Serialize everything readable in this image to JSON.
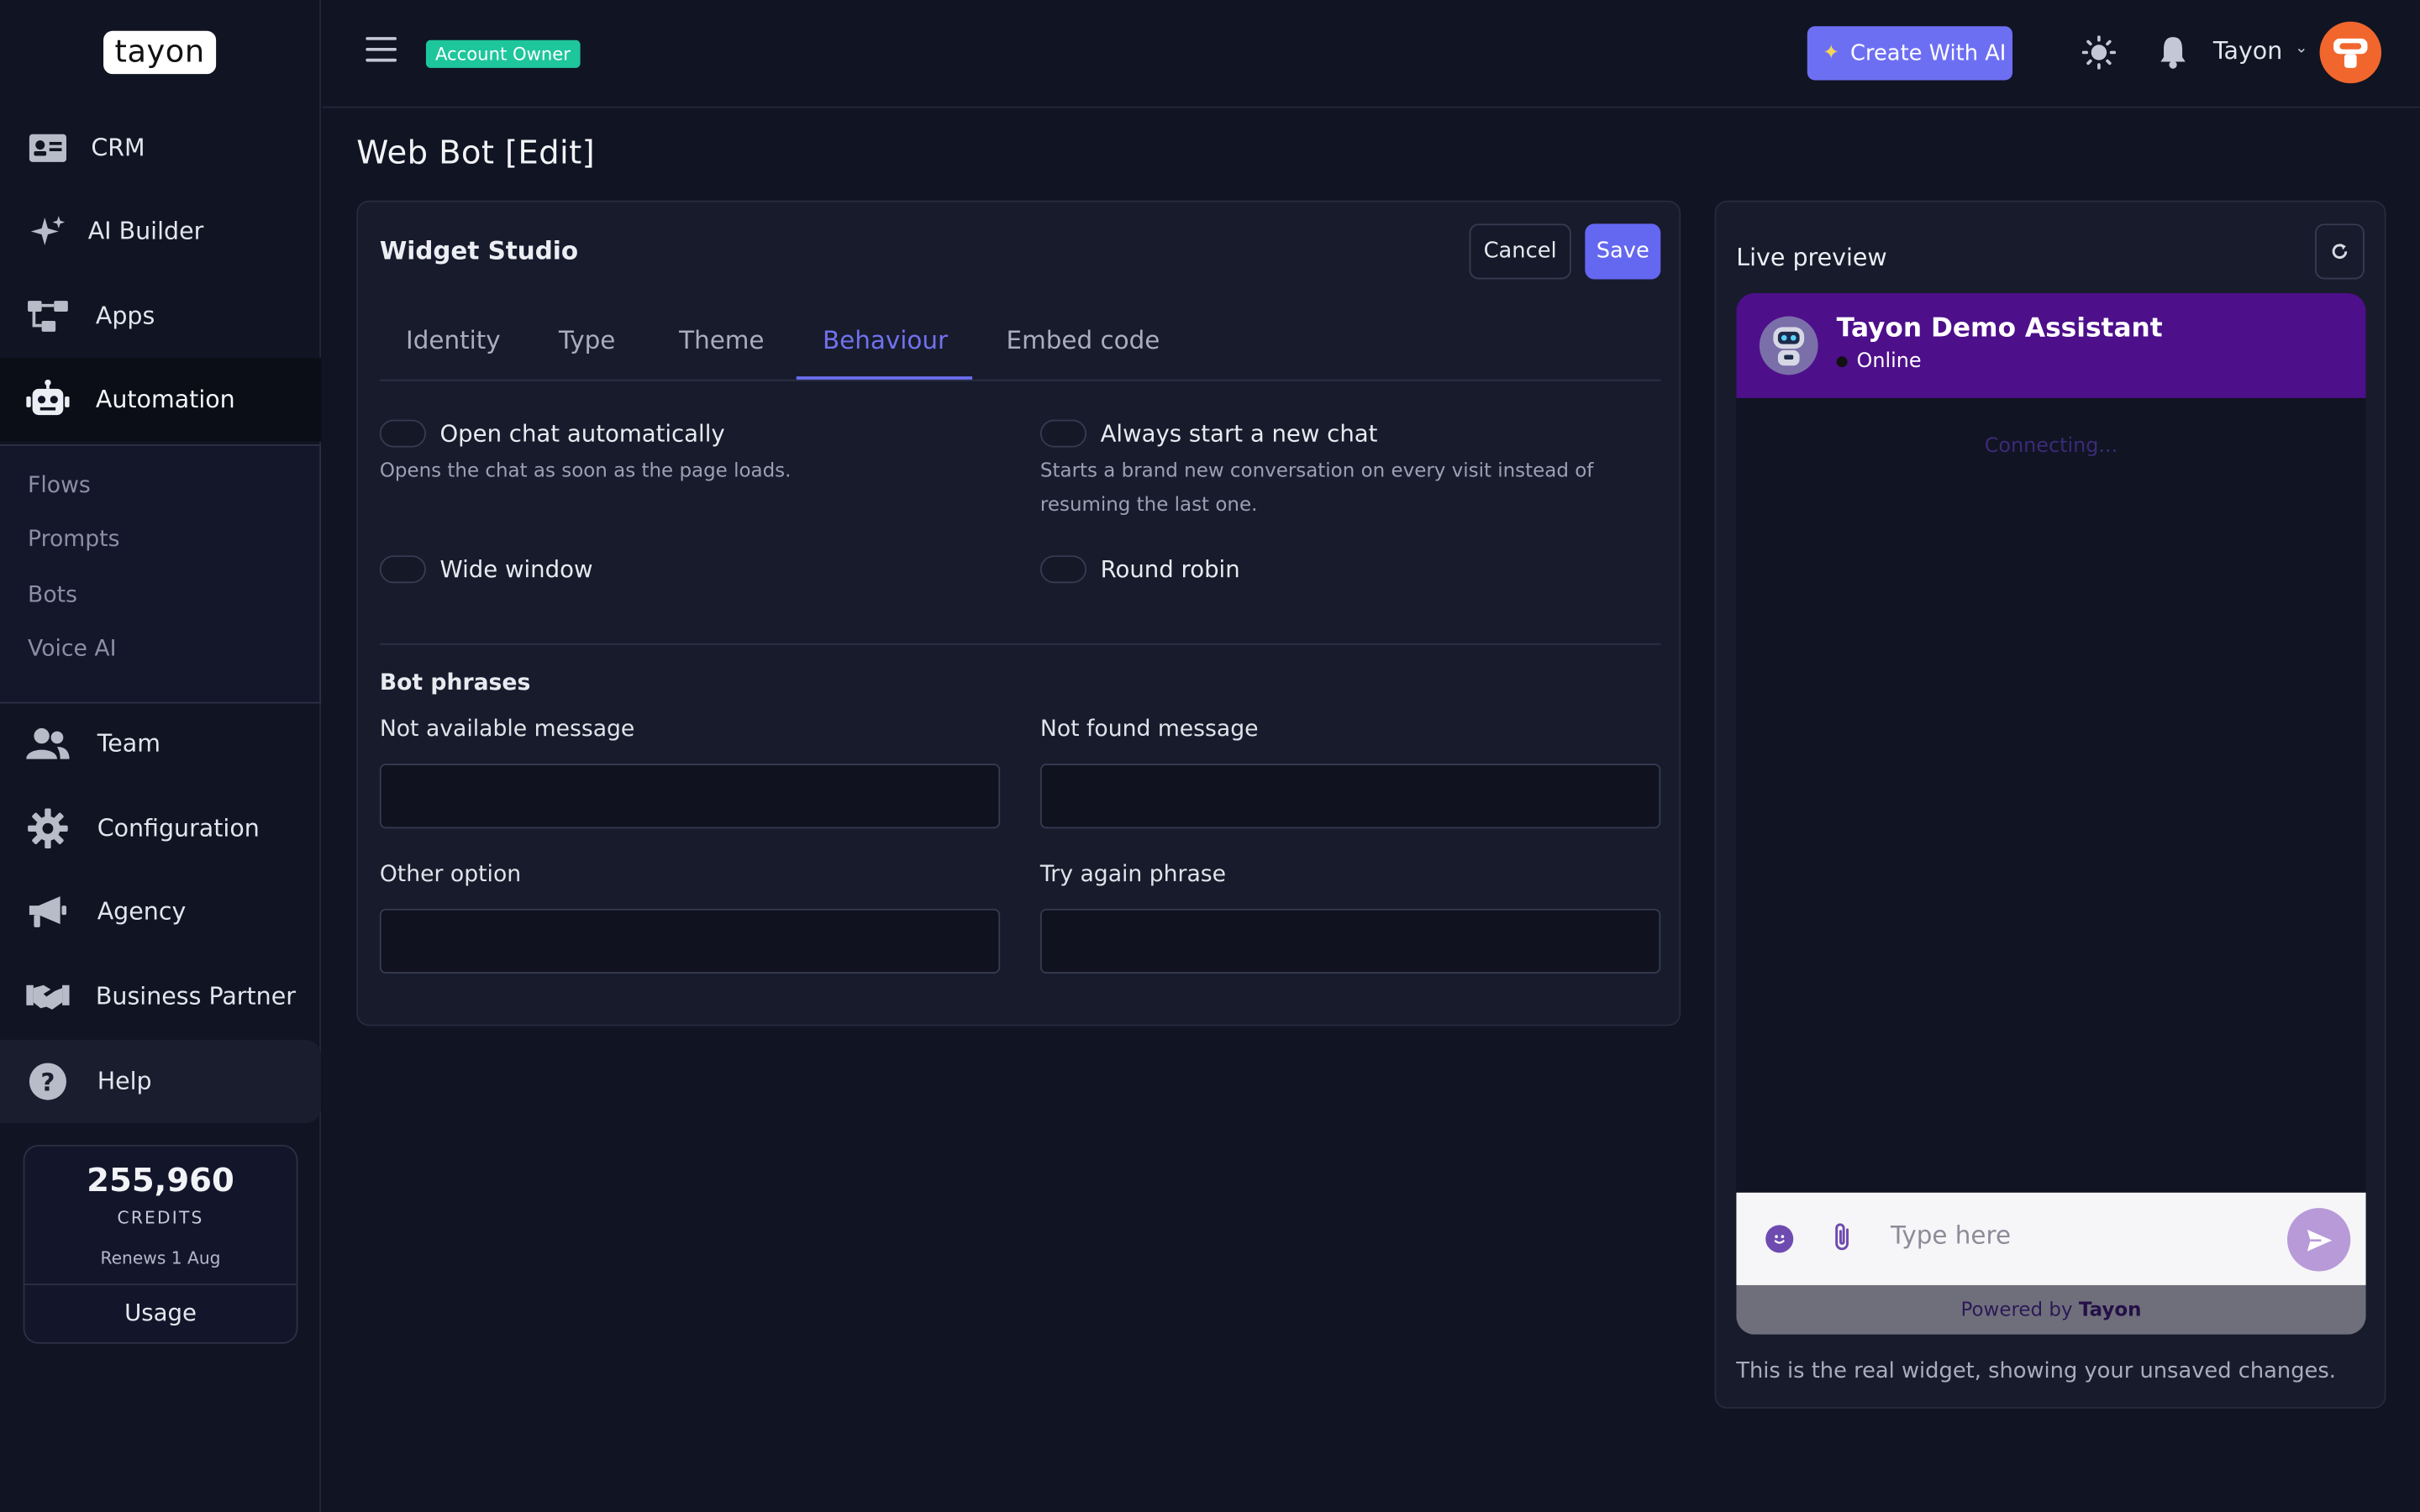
{
  "app": {
    "logo_text": "tayon",
    "role_badge": "Account Owner"
  },
  "sidebar": {
    "items": [
      {
        "label": "CRM",
        "icon": "id-card-icon"
      },
      {
        "label": "AI Builder",
        "icon": "sparkles-icon"
      },
      {
        "label": "Apps",
        "icon": "sitemap-icon"
      },
      {
        "label": "Automation",
        "icon": "robot-icon",
        "active": true
      },
      {
        "label": "Team",
        "icon": "users-icon"
      },
      {
        "label": "Configuration",
        "icon": "gear-icon"
      },
      {
        "label": "Agency",
        "icon": "megaphone-icon"
      },
      {
        "label": "Business Partner",
        "icon": "handshake-icon"
      },
      {
        "label": "Help",
        "icon": "question-circle-icon"
      }
    ],
    "subitems": [
      "Flows",
      "Prompts",
      "Bots",
      "Voice AI"
    ],
    "credits": {
      "amount": "255,960",
      "label": "CREDITS",
      "renews": "Renews 1 Aug",
      "usage_label": "Usage"
    }
  },
  "topbar": {
    "create_ai_label": "Create With AI",
    "user_name": "Tayon"
  },
  "page": {
    "title": "Web Bot [Edit]"
  },
  "studio": {
    "title": "Widget Studio",
    "cancel_label": "Cancel",
    "save_label": "Save",
    "tabs": [
      "Identity",
      "Type",
      "Theme",
      "Behaviour",
      "Embed code"
    ],
    "active_tab": "Behaviour",
    "options": [
      {
        "label": "Open chat automatically",
        "desc": "Opens the chat as soon as the page loads.",
        "on": false
      },
      {
        "label": "Always start a new chat",
        "desc": "Starts a brand new conversation on every visit instead of resuming the last one.",
        "on": false
      },
      {
        "label": "Wide window",
        "desc": "",
        "on": false
      },
      {
        "label": "Round robin",
        "desc": "",
        "on": false
      }
    ],
    "phrases_heading": "Bot phrases",
    "fields": [
      {
        "label": "Not available message",
        "value": ""
      },
      {
        "label": "Not found message",
        "value": ""
      },
      {
        "label": "Other option",
        "value": ""
      },
      {
        "label": "Try again phrase",
        "value": ""
      }
    ]
  },
  "preview": {
    "title": "Live preview",
    "bot_name": "Tayon Demo Assistant",
    "bot_status": "Online",
    "connecting_text": "Connecting...",
    "input_placeholder": "Type here",
    "powered_prefix": "Powered by",
    "powered_brand": "Tayon",
    "note": "This is the real widget, showing your unsaved changes.",
    "header_color": "#4d0f8a"
  },
  "colors": {
    "accent": "#6d6ff3",
    "badge": "#1ec69c",
    "avatar": "#f0662d"
  }
}
